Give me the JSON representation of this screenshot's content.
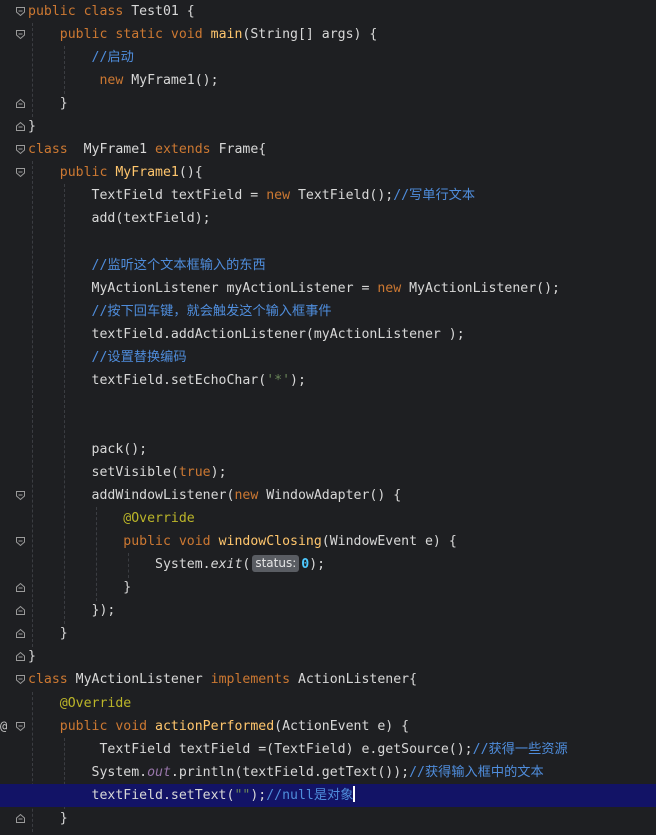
{
  "editor": {
    "lines": [
      [
        {
          "t": "public class ",
          "c": "kw"
        },
        {
          "t": "Test01 {",
          "c": "tx"
        }
      ],
      [
        {
          "t": "    public static void ",
          "c": "kw"
        },
        {
          "t": "main",
          "c": "fn"
        },
        {
          "t": "(String[] args) {",
          "c": "tx"
        }
      ],
      [
        {
          "t": "        //启动",
          "c": "cm"
        }
      ],
      [
        {
          "t": "         new ",
          "c": "kw"
        },
        {
          "t": "MyFrame1();",
          "c": "tx"
        }
      ],
      [
        {
          "t": "    }",
          "c": "tx"
        }
      ],
      [
        {
          "t": "}",
          "c": "tx"
        }
      ],
      [
        {
          "t": "class  ",
          "c": "kw"
        },
        {
          "t": "MyFrame1 ",
          "c": "tx"
        },
        {
          "t": "extends ",
          "c": "kw"
        },
        {
          "t": "Frame{",
          "c": "tx"
        }
      ],
      [
        {
          "t": "    public ",
          "c": "kw"
        },
        {
          "t": "MyFrame1",
          "c": "fn"
        },
        {
          "t": "(){",
          "c": "tx"
        }
      ],
      [
        {
          "t": "        TextField textField = ",
          "c": "tx"
        },
        {
          "t": "new ",
          "c": "kw"
        },
        {
          "t": "TextField();",
          "c": "tx"
        },
        {
          "t": "//写单行文本",
          "c": "cm"
        }
      ],
      [
        {
          "t": "        add(textField);",
          "c": "tx"
        }
      ],
      [],
      [
        {
          "t": "        //监听这个文本框输入的东西",
          "c": "cm"
        }
      ],
      [
        {
          "t": "        MyActionListener myActionListener = ",
          "c": "tx"
        },
        {
          "t": "new ",
          "c": "kw"
        },
        {
          "t": "MyActionListener();",
          "c": "tx"
        }
      ],
      [
        {
          "t": "        //按下回车键，就会触发这个输入框事件",
          "c": "cm"
        }
      ],
      [
        {
          "t": "        textField.addActionListener(myActionListener );",
          "c": "tx"
        }
      ],
      [
        {
          "t": "        //设置替换编码",
          "c": "cm"
        }
      ],
      [
        {
          "t": "        textField.setEchoChar(",
          "c": "tx"
        },
        {
          "t": "'*'",
          "c": "str"
        },
        {
          "t": ");",
          "c": "tx"
        }
      ],
      [],
      [],
      [
        {
          "t": "        pack();",
          "c": "tx"
        }
      ],
      [
        {
          "t": "        setVisible(",
          "c": "tx"
        },
        {
          "t": "true",
          "c": "kw"
        },
        {
          "t": ");",
          "c": "tx"
        }
      ],
      [
        {
          "t": "        addWindowListener(",
          "c": "tx"
        },
        {
          "t": "new ",
          "c": "kw"
        },
        {
          "t": "WindowAdapter() {",
          "c": "tx"
        }
      ],
      [
        {
          "t": "            @Override",
          "c": "ann"
        }
      ],
      [
        {
          "t": "            public void ",
          "c": "kw"
        },
        {
          "t": "windowClosing",
          "c": "fn"
        },
        {
          "t": "(WindowEvent e) {",
          "c": "tx"
        }
      ],
      [
        {
          "t": "                System.",
          "c": "tx"
        },
        {
          "t": "exit",
          "c": "tx it"
        },
        {
          "t": "(",
          "c": "tx"
        },
        {
          "t": "status:",
          "c": "hint"
        },
        {
          "t": "0",
          "c": "num"
        },
        {
          "t": ");",
          "c": "tx"
        }
      ],
      [
        {
          "t": "            }",
          "c": "tx"
        }
      ],
      [
        {
          "t": "        });",
          "c": "tx"
        }
      ],
      [
        {
          "t": "    }",
          "c": "tx"
        }
      ],
      [
        {
          "t": "}",
          "c": "tx"
        }
      ],
      [
        {
          "t": "class ",
          "c": "kw"
        },
        {
          "t": "MyActionListener ",
          "c": "tx"
        },
        {
          "t": "implements ",
          "c": "kw"
        },
        {
          "t": "ActionListener{",
          "c": "tx"
        }
      ],
      [
        {
          "t": "    @Override",
          "c": "ann"
        }
      ],
      [
        {
          "t": "    public void ",
          "c": "kw"
        },
        {
          "t": "actionPerformed",
          "c": "fn"
        },
        {
          "t": "(ActionEvent e) {",
          "c": "tx"
        }
      ],
      [
        {
          "t": "         TextField textField =(TextField) e.getSource();",
          "c": "tx"
        },
        {
          "t": "//获得一些资源",
          "c": "cm"
        }
      ],
      [
        {
          "t": "        System.",
          "c": "tx"
        },
        {
          "t": "out",
          "c": "field"
        },
        {
          "t": ".println(textField.getText());",
          "c": "tx"
        },
        {
          "t": "//获得输入框中的文本",
          "c": "cm"
        }
      ],
      [
        {
          "t": "        textField.setText(",
          "c": "tx"
        },
        {
          "t": "\"\"",
          "c": "str"
        },
        {
          "t": ");",
          "c": "tx"
        },
        {
          "t": "//null是对象",
          "c": "cm"
        },
        {
          "t": "",
          "c": "caret"
        }
      ],
      [
        {
          "t": "    }",
          "c": "tx"
        }
      ]
    ],
    "current_line": 34,
    "gutter_marker_line": 31,
    "gutter_marker": "@",
    "fold_open_lines": [
      0,
      1,
      6,
      7,
      21,
      23,
      29,
      31
    ],
    "fold_close_lines": [
      4,
      5,
      25,
      26,
      27,
      28,
      35
    ]
  }
}
